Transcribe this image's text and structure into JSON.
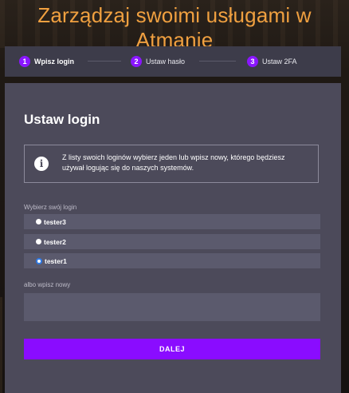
{
  "page": {
    "heading": "Zarządzaj swoimi usługami w Atmanie"
  },
  "stepper": {
    "steps": [
      {
        "number": "1",
        "label": "Wpisz login",
        "active": true
      },
      {
        "number": "2",
        "label": "Ustaw hasło",
        "active": false
      },
      {
        "number": "3",
        "label": "Ustaw 2FA",
        "active": false
      }
    ]
  },
  "form": {
    "title": "Ustaw login",
    "info_icon": "info-icon",
    "info_text": "Z listy swoich loginów wybierz jeden lub wpisz nowy, którego będziesz używał logując się do naszych systemów.",
    "choose_label": "Wybierz swój login",
    "options": [
      {
        "label": "tester3",
        "selected": false
      },
      {
        "label": "tester2",
        "selected": false
      },
      {
        "label": "tester1",
        "selected": true
      }
    ],
    "new_label": "albo wpisz nowy",
    "new_value": "",
    "new_placeholder": "",
    "submit_label": "DALEJ"
  },
  "colors": {
    "accent": "#8a0cff",
    "heading": "#f0a040",
    "panel": "#4c4a5a"
  }
}
